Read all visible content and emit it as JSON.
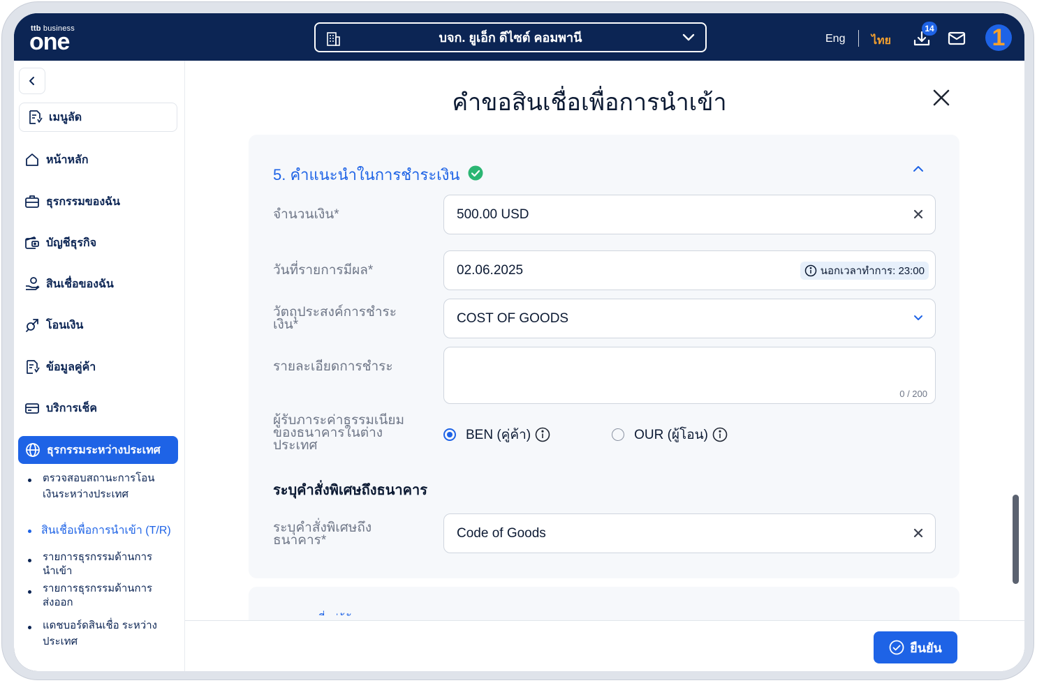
{
  "brand": {
    "small": "ttb",
    "small_suffix": "business",
    "name": "one"
  },
  "header": {
    "company": "บจก. ยูเอ็ก ดีไซต์ คอมพานี",
    "lang_en": "Eng",
    "lang_th": "ไทย",
    "download_badge": "14",
    "avatar_text": "1"
  },
  "sidebar": {
    "shortcut": "เมนูลัด",
    "items": [
      {
        "label": "หน้าหลัก",
        "icon": "home-icon"
      },
      {
        "label": "ธุรกรรมของฉัน",
        "icon": "briefcase-icon"
      },
      {
        "label": "บัญชีธุรกิจ",
        "icon": "wallet-icon"
      },
      {
        "label": "สินเชื่อของฉัน",
        "icon": "loan-icon"
      },
      {
        "label": "โอนเงิน",
        "icon": "transfer-icon"
      },
      {
        "label": "ข้อมูลคู่ค้า",
        "icon": "partner-icon"
      },
      {
        "label": "บริการเช็ค",
        "icon": "cheque-icon"
      }
    ],
    "active": "ธุรกรรมระหว่างประเทศ",
    "sub": [
      {
        "line1": "ตรวจสอบสถานะการโอน",
        "line2": "เงินระหว่างประเทศ"
      },
      {
        "line1": "สินเชื่อเพื่อการนำเข้า (T/R)"
      },
      {
        "line1": "รายการธุรกรรมด้านการ",
        "line2": "นำเข้า"
      },
      {
        "line1": "รายการธุรกรรมด้านการ",
        "line2": "ส่งออก"
      },
      {
        "line1": "แดชบอร์ดสินเชื่อ ระหว่าง",
        "line2": "ประเทศ"
      }
    ]
  },
  "page": {
    "title": "คำขอสินเชื่อเพื่อการนำเข้า",
    "section_title": "5. คำแนะนำในการชำระเงิน",
    "fields": {
      "amount_label": "จำนวนเงิน*",
      "amount_value": "500.00 USD",
      "date_label": "วันที่รายการมีผล*",
      "date_value": "02.06.2025",
      "hours_label": "นอกเวลาทำการ: 23:00",
      "purpose_label_l1": "วัตถุประสงค์การชำระ",
      "purpose_label_l2": "เงิน*",
      "purpose_value": "COST OF GOODS",
      "details_label": "รายละเอียดการชำระ",
      "details_counter": "0 / 200",
      "fee_label_l1": "ผู้รับภาระค่าธรรมเนียม",
      "fee_label_l2": "ของธนาคารในต่าง",
      "fee_label_l3": "ประเทศ",
      "fee_ben": "BEN (คู่ค้า)",
      "fee_our": "OUR (ผู้โอน)",
      "special_heading": "ระบุคำสั่งพิเศษถึงธนาคาร",
      "special_label_l1": "ระบุคำสั่งพิเศษถึง",
      "special_label_l2": "ธนาคาร*",
      "special_value": "Code of Goods"
    },
    "next_section_peek": "ที่อยู่ผู้รับ",
    "confirm": "ยืนยัน"
  },
  "colors": {
    "navy": "#0c2554",
    "blue": "#1e63e6",
    "orange": "#f6a12e",
    "green": "#2bb673"
  }
}
